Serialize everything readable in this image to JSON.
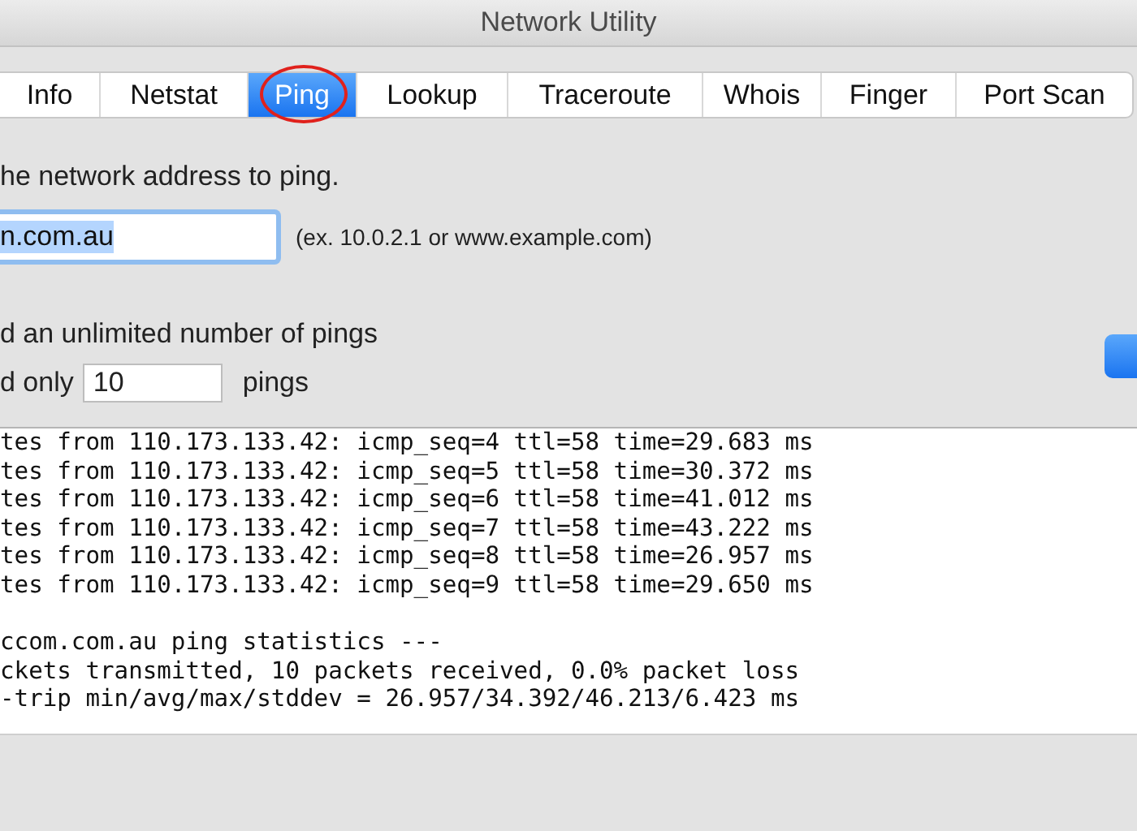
{
  "window": {
    "title": "Network Utility"
  },
  "tabs": [
    {
      "label": "Info",
      "selected": false,
      "highlighted": false
    },
    {
      "label": "Netstat",
      "selected": false,
      "highlighted": false
    },
    {
      "label": "Ping",
      "selected": true,
      "highlighted": true
    },
    {
      "label": "Lookup",
      "selected": false,
      "highlighted": false
    },
    {
      "label": "Traceroute",
      "selected": false,
      "highlighted": false
    },
    {
      "label": "Whois",
      "selected": false,
      "highlighted": false
    },
    {
      "label": "Finger",
      "selected": false,
      "highlighted": false
    },
    {
      "label": "Port Scan",
      "selected": false,
      "highlighted": false
    }
  ],
  "prompt": "he network address to ping.",
  "address_field": {
    "value": "n.com.au",
    "selected_text": true
  },
  "address_hint": "(ex. 10.0.2.1 or www.example.com)",
  "options": [
    {
      "kind": "plain",
      "label": "d an unlimited number of pings"
    },
    {
      "kind": "count",
      "label": "d only",
      "value": "10",
      "suffix": "pings"
    }
  ],
  "output_blocks": [
    [
      "tes from 110.173.133.42: icmp_seq=4 ttl=58 time=29.683 ms",
      "tes from 110.173.133.42: icmp_seq=5 ttl=58 time=30.372 ms",
      "tes from 110.173.133.42: icmp_seq=6 ttl=58 time=41.012 ms",
      "tes from 110.173.133.42: icmp_seq=7 ttl=58 time=43.222 ms",
      "tes from 110.173.133.42: icmp_seq=8 ttl=58 time=26.957 ms",
      "tes from 110.173.133.42: icmp_seq=9 ttl=58 time=29.650 ms"
    ],
    [
      "ccom.com.au ping statistics ---",
      "ckets transmitted, 10 packets received, 0.0% packet loss",
      "-trip min/avg/max/stddev = 26.957/34.392/46.213/6.423 ms"
    ]
  ]
}
